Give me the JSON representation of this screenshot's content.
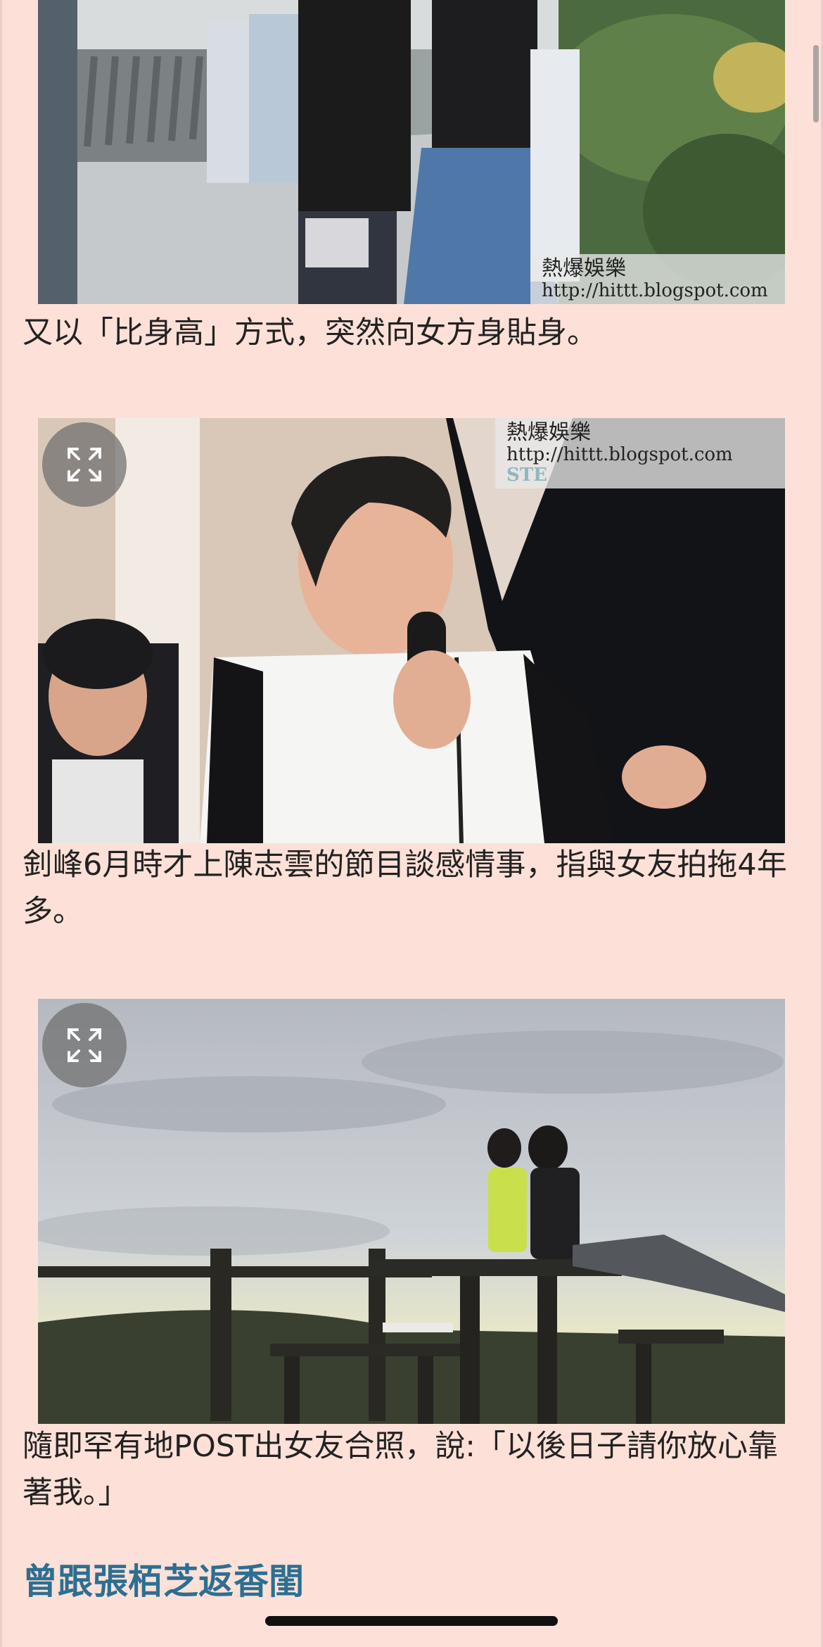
{
  "article": {
    "photos": [
      {
        "watermark_name": "熱爆娛樂",
        "watermark_url": "http://hittt.blogspot.com"
      },
      {
        "watermark_name": "熱爆娛樂",
        "watermark_url": "http://hittt.blogspot.com",
        "extra_text": "STE"
      },
      {}
    ],
    "captions": [
      "又以「比身高」方式，突然向女方身貼身。",
      "釗峰6月時才上陳志雲的節目談感情事，指與女友拍拖4年多。",
      "隨即罕有地POST出女友合照，說:「以後日子請你放心靠著我。」"
    ],
    "section_heading": "曾跟張栢芝返香閨"
  },
  "icons": {
    "expand": "expand-icon"
  },
  "colors": {
    "background": "#fde1d8",
    "heading": "#2c6f91"
  }
}
